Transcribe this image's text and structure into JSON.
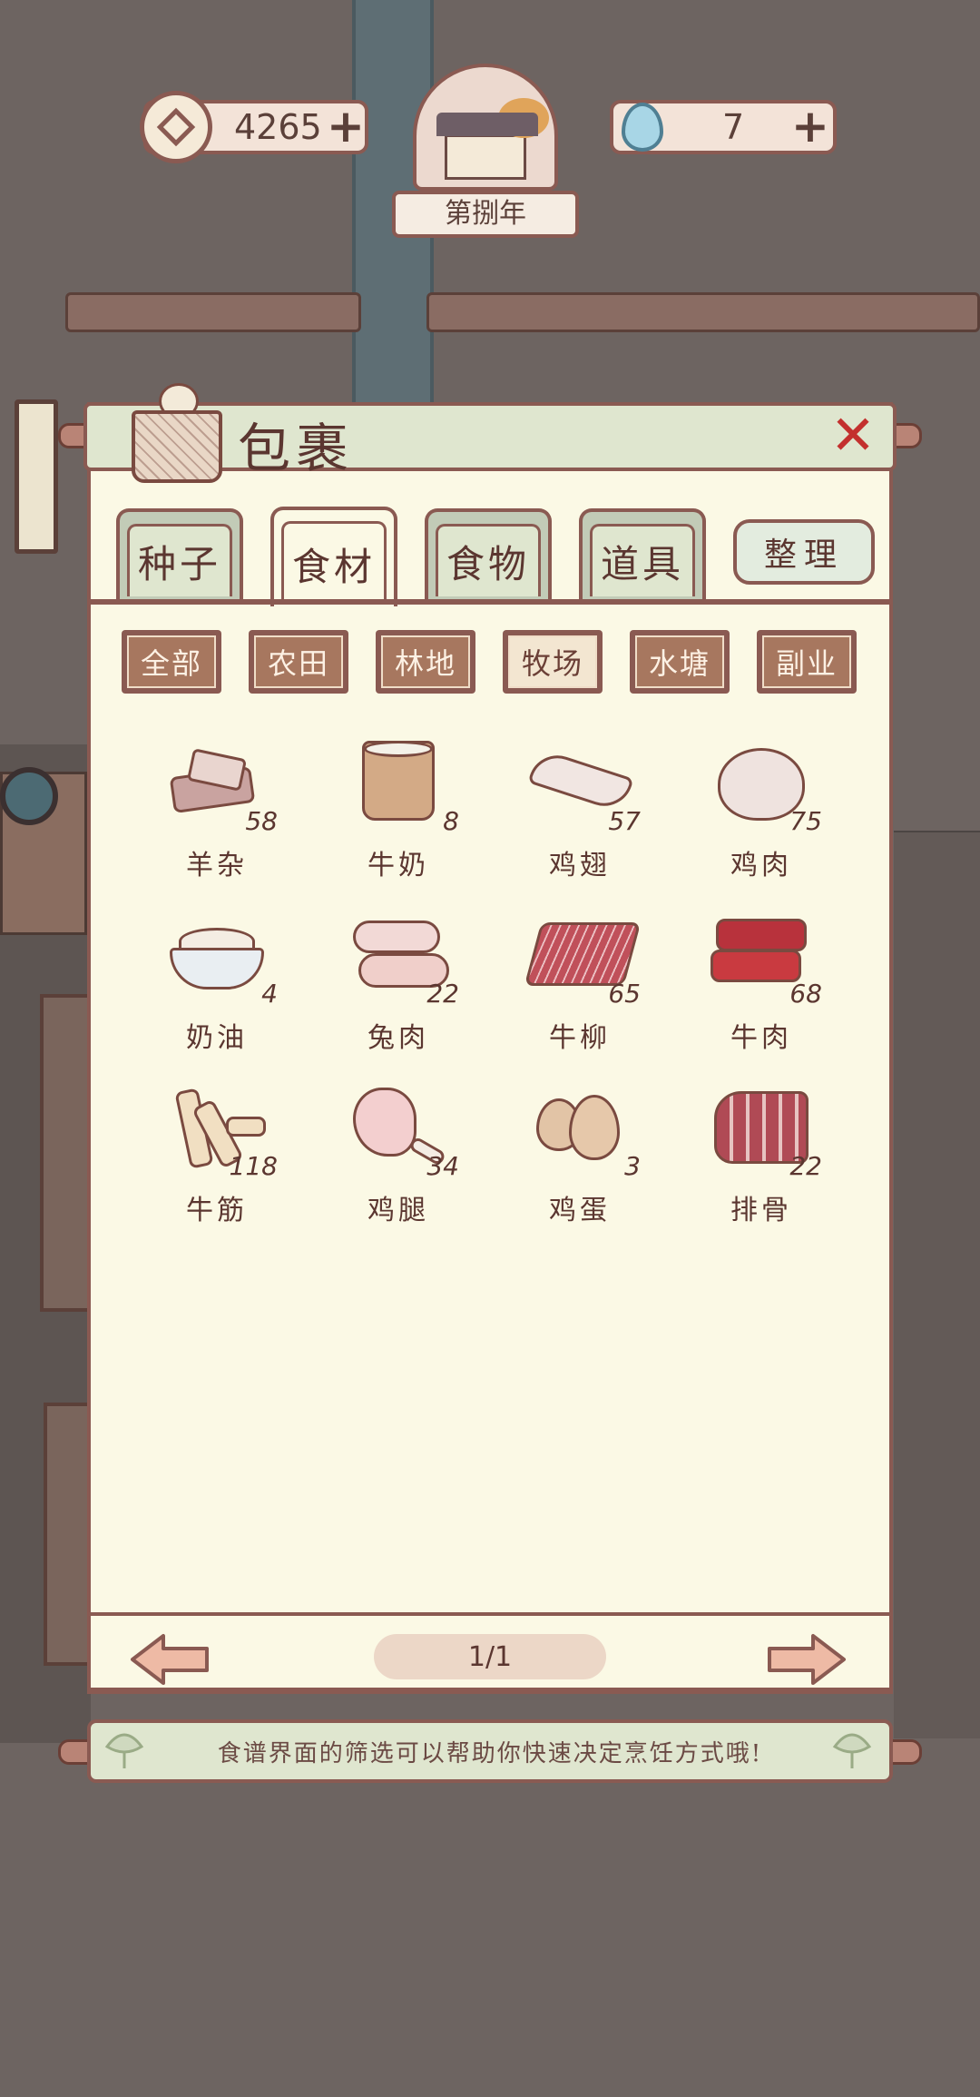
{
  "hud": {
    "coins": "4265",
    "spirit": "7",
    "year": "第捌年",
    "coin_icon": "coin-icon",
    "spirit_icon": "water-drop-icon"
  },
  "panel": {
    "title": "包裹",
    "tabs": [
      {
        "label": "种子",
        "active": false
      },
      {
        "label": "食材",
        "active": true
      },
      {
        "label": "食物",
        "active": false
      },
      {
        "label": "道具",
        "active": false
      }
    ],
    "sort_label": "整理",
    "filters": [
      {
        "label": "全部",
        "active": false
      },
      {
        "label": "农田",
        "active": false
      },
      {
        "label": "林地",
        "active": false
      },
      {
        "label": "牧场",
        "active": true
      },
      {
        "label": "水塘",
        "active": false
      },
      {
        "label": "副业",
        "active": false
      }
    ],
    "items": [
      {
        "name": "羊杂",
        "count": "58"
      },
      {
        "name": "牛奶",
        "count": "8"
      },
      {
        "name": "鸡翅",
        "count": "57"
      },
      {
        "name": "鸡肉",
        "count": "75"
      },
      {
        "name": "奶油",
        "count": "4"
      },
      {
        "name": "兔肉",
        "count": "22"
      },
      {
        "name": "牛柳",
        "count": "65"
      },
      {
        "name": "牛肉",
        "count": "68"
      },
      {
        "name": "牛筋",
        "count": "118"
      },
      {
        "name": "鸡腿",
        "count": "34"
      },
      {
        "name": "鸡蛋",
        "count": "3"
      },
      {
        "name": "排骨",
        "count": "22"
      }
    ],
    "page_indicator": "1/1",
    "tip": "食谱界面的筛选可以帮助你快速决定烹饪方式哦!"
  },
  "colors": {
    "background": "#6d6461",
    "panel": "#fbf9e5",
    "border": "#8a5a52",
    "close": "#c3302e",
    "filter_active": "#f3e6d1",
    "filter": "#a7775f"
  }
}
